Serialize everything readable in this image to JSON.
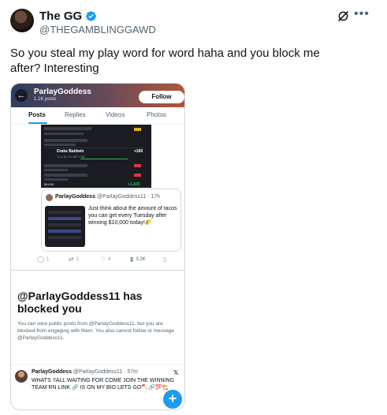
{
  "author": {
    "display_name": "The GG",
    "handle": "@THEGAMBLINGGAWD"
  },
  "tweet_text": "So you steal my play word for word haha and you block me after? Interesting",
  "icons": {
    "verified": "verified-badge-icon",
    "grok": "grok-icon",
    "more": "more-icon"
  },
  "colors": {
    "accent": "#1d9bf0",
    "text": "#0f1419",
    "muted": "#536471"
  },
  "screenshot": {
    "profile_name": "ParlayGoddess",
    "profile_posts": "1.1K posts",
    "follow_label": "Follow",
    "back_glyph": "←",
    "tabs": [
      "Posts",
      "Replies",
      "Videos",
      "Photos"
    ],
    "betslip": {
      "leg_name": "Drake Baldwin",
      "leg_odds": "+360",
      "leg_sub": "TL 1.5 • 1+ HIT • ML",
      "footer_left": "$14.00",
      "footer_right": "+1,425"
    },
    "quote": {
      "name": "ParlayGoddess",
      "handle_time": "@ParlayGoddess11 · 17h",
      "text": "Just think about the amount of tacos you can get every Tuesday after winning $10,000 today!🌮"
    },
    "actions": {
      "replies": "1",
      "reposts": "2",
      "likes": "4",
      "views": "3.3K"
    },
    "blocked_title": "@ParlayGoddess11 has blocked you",
    "blocked_body": "You can view public posts from @ParlayGoddess11, but you are blocked from engaging with them. You also cannot follow or message @ParlayGoddess11.",
    "bottom_tweet": {
      "name": "ParlayGoddess",
      "handle_time": "@ParlayGoddess11 · 57m",
      "text": "WHATS YALL WAITING FOR COME JOIN THE WINNING TEAM RN LINK 🔗 IS ON MY BIO LETS GO🪓🔗💯🏗️"
    },
    "fab_label": "+"
  }
}
